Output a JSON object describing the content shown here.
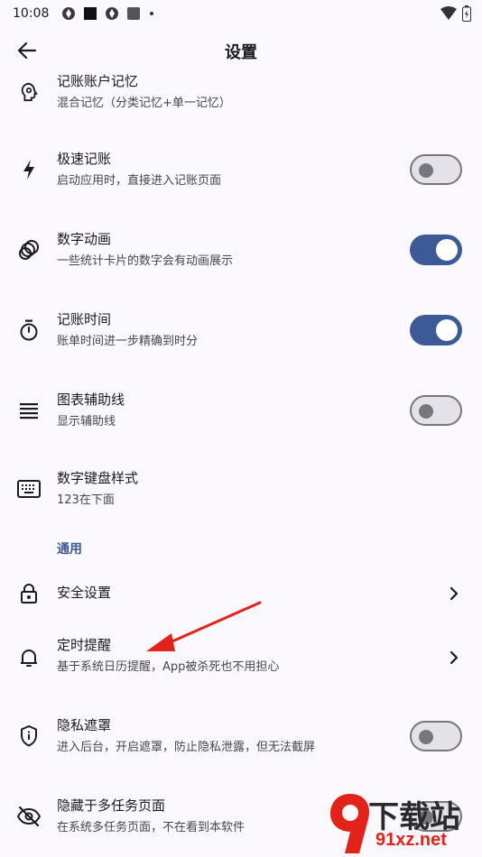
{
  "status_bar": {
    "time": "10:08"
  },
  "header": {
    "title": "设置"
  },
  "settings": [
    {
      "title": "记账账户记忆",
      "subtitle": "混合记忆（分类记忆+单一记忆）"
    },
    {
      "title": "极速记账",
      "subtitle": "启动应用时，直接进入记账页面",
      "toggle": "off"
    },
    {
      "title": "数字动画",
      "subtitle": "一些统计卡片的数字会有动画展示",
      "toggle": "on"
    },
    {
      "title": "记账时间",
      "subtitle": "账单时间进一步精确到时分",
      "toggle": "on"
    },
    {
      "title": "图表辅助线",
      "subtitle": "显示辅助线",
      "toggle": "off"
    },
    {
      "title": "数字键盘样式",
      "subtitle": "123在下面"
    }
  ],
  "section_general": {
    "label": "通用"
  },
  "general": [
    {
      "title": "安全设置"
    },
    {
      "title": "定时提醒",
      "subtitle": "基于系统日历提醒，App被杀死也不用担心"
    },
    {
      "title": "隐私遮罩",
      "subtitle": "进入后台，开启遮罩，防止隐私泄露，但无法截屏",
      "toggle": "off"
    },
    {
      "title": "隐藏于多任务页面",
      "subtitle": "在系统多任务页面，不在看到本软件"
    }
  ],
  "watermark": {
    "line1": "下载站",
    "line2": "91xz.net"
  },
  "colors": {
    "accent": "#3c5b96",
    "background": "#fbf8fd",
    "arrow": "#e2231a"
  }
}
